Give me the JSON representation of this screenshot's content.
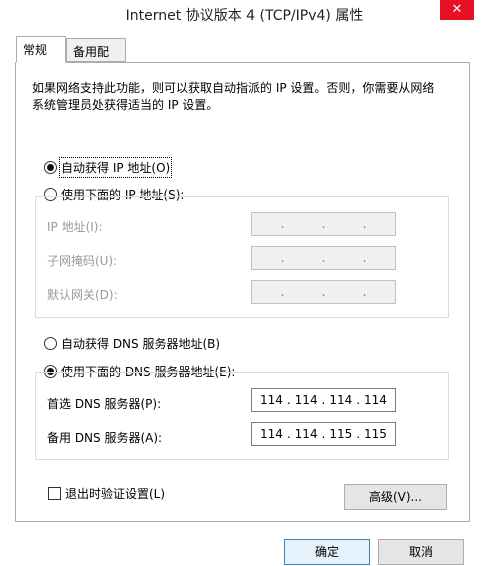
{
  "window": {
    "title": "Internet 协议版本 4 (TCP/IPv4) 属性",
    "close_glyph": "✕"
  },
  "tabs": [
    {
      "label": "常规",
      "active": true
    },
    {
      "label": "备用配置",
      "active": false
    }
  ],
  "description": "如果网络支持此功能，则可以获取自动指派的 IP 设置。否则，你需要从网络系统管理员处获得适当的 IP 设置。",
  "ip_section": {
    "auto_label": "自动获得 IP 地址(O)",
    "manual_label": "使用下面的 IP 地址(S):",
    "auto_selected": true,
    "fields": [
      {
        "label": "IP 地址(I):",
        "value": [
          ".",
          ".",
          "."
        ]
      },
      {
        "label": "子网掩码(U):",
        "value": [
          ".",
          ".",
          "."
        ]
      },
      {
        "label": "默认网关(D):",
        "value": [
          ".",
          ".",
          "."
        ]
      }
    ]
  },
  "dns_section": {
    "auto_label": "自动获得 DNS 服务器地址(B)",
    "manual_label": "使用下面的 DNS 服务器地址(E):",
    "manual_selected": true,
    "preferred_label": "首选 DNS 服务器(P):",
    "preferred_value": [
      "114",
      ".",
      "114",
      ".",
      "114",
      ".",
      "114"
    ],
    "alternate_label": "备用 DNS 服务器(A):",
    "alternate_value": [
      "114",
      ".",
      "114",
      ".",
      "115",
      ".",
      "115"
    ]
  },
  "validate_label": "退出时验证设置(L)",
  "advanced_button": "高级(V)...",
  "ok_button": "确定",
  "cancel_button": "取消"
}
